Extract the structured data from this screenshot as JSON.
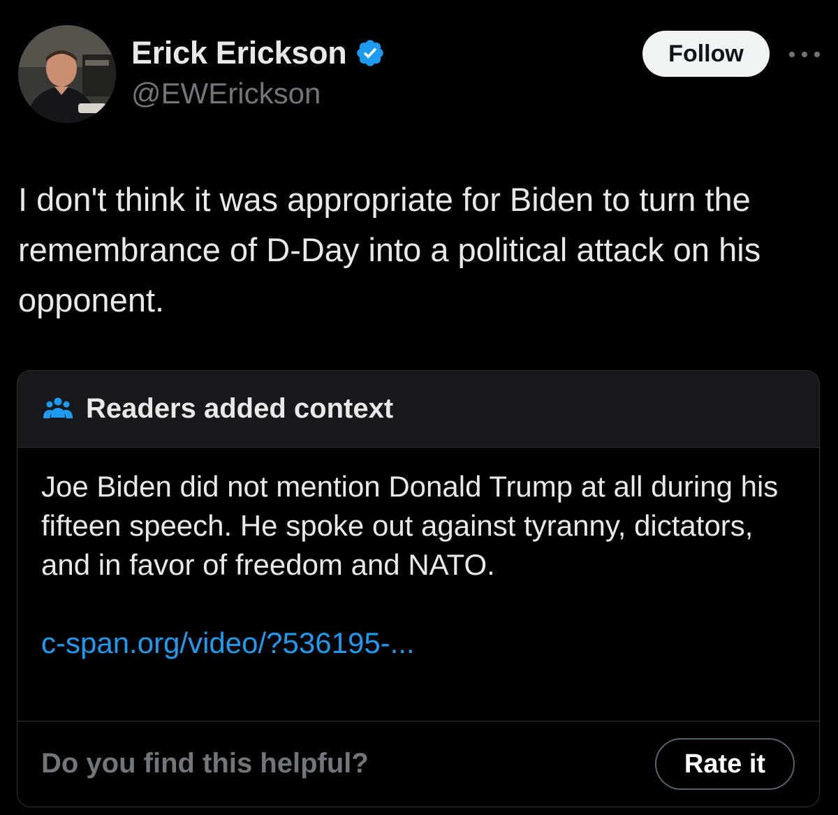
{
  "author": {
    "display_name": "Erick Erickson",
    "handle": "@EWErickson",
    "verified": true,
    "avatar_icon": "profile-photo"
  },
  "actions": {
    "follow_label": "Follow",
    "more_icon": "more-horizontal-icon"
  },
  "tweet": {
    "text": "I don't think it was appropriate for Biden to turn the remembrance of D-Day into a political attack on his opponent."
  },
  "community_note": {
    "header_icon": "people-icon",
    "header_title": "Readers added context",
    "body": "Joe Biden did not mention Donald Trump at all during his fifteen speech. He spoke out against tyranny, dictators, and in favor of freedom and NATO.",
    "link_text": "c-span.org/video/?536195-...",
    "helpful_question": "Do you find this helpful?",
    "rate_label": "Rate it"
  },
  "colors": {
    "background": "#000000",
    "primary_text": "#e7e9ea",
    "secondary_text": "#71767b",
    "link": "#1d9bf0",
    "verified_badge": "#1d9bf0",
    "note_header_bg": "#16181c",
    "border": "#2f3336"
  }
}
